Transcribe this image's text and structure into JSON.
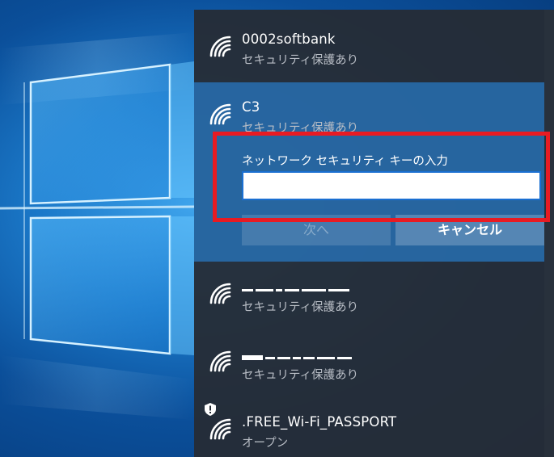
{
  "colors": {
    "flyout_bg": "#262c34",
    "selected_bg": "#276aa8",
    "highlight": "#e81b23",
    "input_border": "#1a6fd1"
  },
  "networks": [
    {
      "ssid": "0002softbank",
      "status": "セキュリティ保護あり",
      "icon": "wifi-icon",
      "masked": false
    },
    {
      "ssid": "C3",
      "status": "セキュリティ保護あり",
      "icon": "wifi-icon",
      "masked": false,
      "selected": true
    },
    {
      "ssid": "",
      "status": "セキュリティ保護あり",
      "icon": "wifi-icon",
      "masked": true
    },
    {
      "ssid": "",
      "status": "セキュリティ保護あり",
      "icon": "wifi-icon",
      "masked": true
    },
    {
      "ssid": ".FREE_Wi-Fi_PASSPORT",
      "status": "オープン",
      "icon": "wifi-shield-icon",
      "masked": false
    }
  ],
  "connect_form": {
    "key_label": "ネットワーク セキュリティ キーの入力",
    "key_value": "",
    "next_label": "次へ",
    "cancel_label": "キャンセル"
  }
}
